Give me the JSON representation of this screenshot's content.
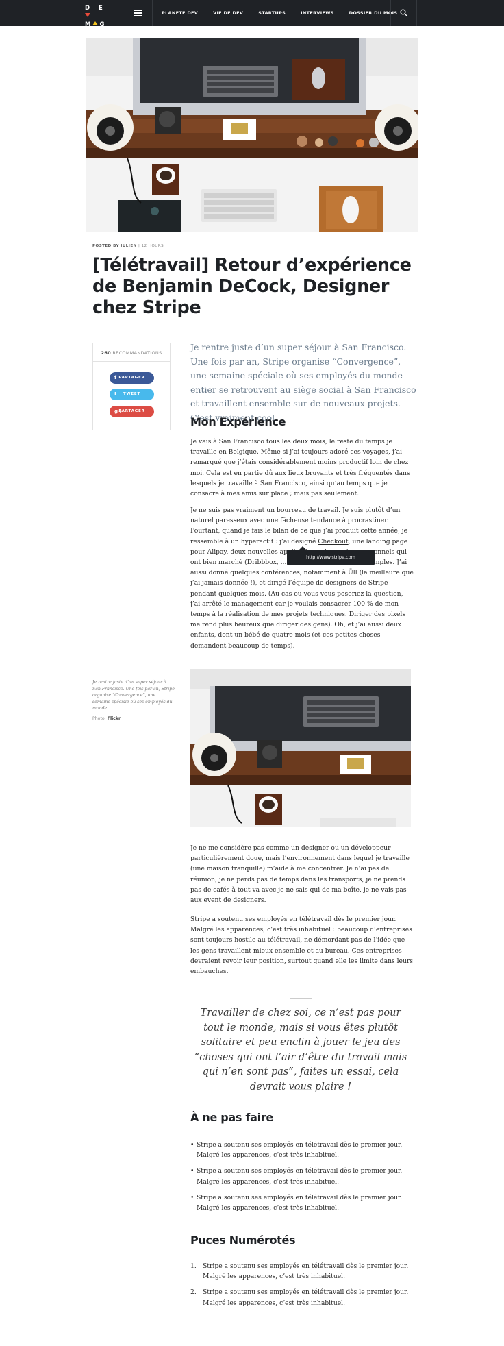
{
  "header": {
    "logo_line1": "D E",
    "logo_line2": "M",
    "logo_line2b": "G",
    "nav": [
      "PLANETE DEV",
      "VIE DE DEV",
      "STARTUPS",
      "INTERVIEWS",
      "DOSSIER DU MOIS"
    ],
    "menu_icon": "hamburger-icon",
    "search_icon": "search-icon"
  },
  "byline": {
    "prefix": "POSTED BY",
    "author": "JULIEN",
    "sep": "|",
    "time": "12 HOURS"
  },
  "title": "[Télétravail] Retour d’expérience de Benjamin DeCock, Designer chez Stripe",
  "share": {
    "count": "260",
    "count_label": "RECOMMANDATIONS",
    "buttons": [
      {
        "label": "PARTAGER",
        "icon": "f",
        "color": "#3b5998"
      },
      {
        "label": "TWEET",
        "icon": "t",
        "color": "#48b9ec"
      },
      {
        "label": "PARTAGER",
        "icon": "g+",
        "color": "#dc4c44"
      }
    ]
  },
  "lead": "Je rentre juste d’un super séjour à San Francisco. Une fois par an, Stripe organise “Convergence”, une semaine spéciale où ses employés du monde entier se retrouvent au siège social à San Francisco et travaillent ensemble sur de nouveaux projets. C’est vraiment cool.",
  "section1": {
    "heading": "Mon Expérience",
    "p1": "Je vais à San Francisco tous les deux mois, le reste du temps je travaille en Belgique. Même si j’ai toujours adoré ces voyages, j’ai remarqué que j’étais considérablement moins productif loin de chez moi. Cela est en partie dû aux lieux bruyants et très fréquentés dans lesquels je travaille à San Francisco, ainsi qu’au temps que je consacre à mes amis sur place ; mais pas seulement.",
    "p2a": "Je ne suis pas vraiment un bourreau de travail. Je suis plutôt d’un naturel paresseux avec une fâcheuse tendance à procrastiner. Pourtant, quand je fais le bilan de ce que j’ai produit cette année, je ressemble à un hyperactif : j’ai designé ",
    "p2_link": "Checkout",
    "p2b": ", une landing page pour Alipay, deux nouvelles applications, des projets personnels qui ont bien marché (Dribbbox, ...), pour ne citer que ces exemples. J’ai aussi donné quelques conférences, notamment à Üll (la meilleure que j’ai jamais donnée !), et dirigé l’équipe de designers de Stripe pendant quelques mois. (Au cas où vous vous poseriez la question, j’ai arrêté le management car je voulais consacrer 100 % de mon temps à la réalisation de mes projets techniques. Diriger des pixels me rend plus heureux que diriger des gens). Oh, et j’ai aussi deux enfants, dont un bébé de quatre mois (et ces petites choses demandent beaucoup de temps).",
    "tooltip": "http://www.stripe.com"
  },
  "photo_caption": "Je rentre juste d’un super séjour à San Francisco. Une fois par an, Stripe organise “Convergence”, une semaine spéciale où ses employés du monde.",
  "photo_credit_label": "Photo:",
  "photo_credit": "Flickr",
  "section2": {
    "p1": "Je ne me considère pas comme un designer ou un développeur particulièrement doué, mais l’environnement dans lequel je travaille (une maison tranquille) m’aide à me concentrer. Je n’ai pas de réunion, je ne perds pas de temps dans les transports, je ne prends pas de cafés à tout va avec je ne sais qui de ma boîte, je ne vais pas aux event de designers.",
    "p2": "Stripe a soutenu ses employés en télétravail dès le premier jour. Malgré les apparences, c’est très inhabituel : beaucoup d’entreprises sont toujours hostile au télétravail, ne démordant pas de l’idée que les gens travaillent mieux ensemble et au bureau. Ces entreprises devraient revoir leur position, surtout quand elle les limite dans leurs embauches."
  },
  "quote": "Travailler de chez soi, ce n’est pas pour tout le monde, mais si vous êtes plutôt solitaire et peu enclin à jouer le jeu des “choses qui ont l’air d’être du travail mais qui n’en sont pas”, faites un essai, cela devrait vous plaire !",
  "section3": {
    "heading": "À ne pas faire",
    "bullet": "•",
    "items": [
      "Stripe a soutenu ses employés en télétravail dès le premier jour. Malgré les apparences, c’est très inhabituel.",
      "Stripe a soutenu ses employés en télétravail dès le premier jour. Malgré les apparences, c’est très inhabituel.",
      "Stripe a soutenu ses employés en télétravail dès le premier jour. Malgré les apparences, c’est très inhabituel."
    ]
  },
  "section4": {
    "heading": "Puces Numérotés",
    "items": [
      {
        "num": "1.",
        "text": "Stripe a soutenu ses employés en télétravail dès le premier jour. Malgré les apparences, c’est très inhabituel."
      },
      {
        "num": "2.",
        "text": "Stripe a soutenu ses employés en télétravail dès le premier jour. Malgré les apparences, c’est très inhabituel."
      }
    ]
  }
}
